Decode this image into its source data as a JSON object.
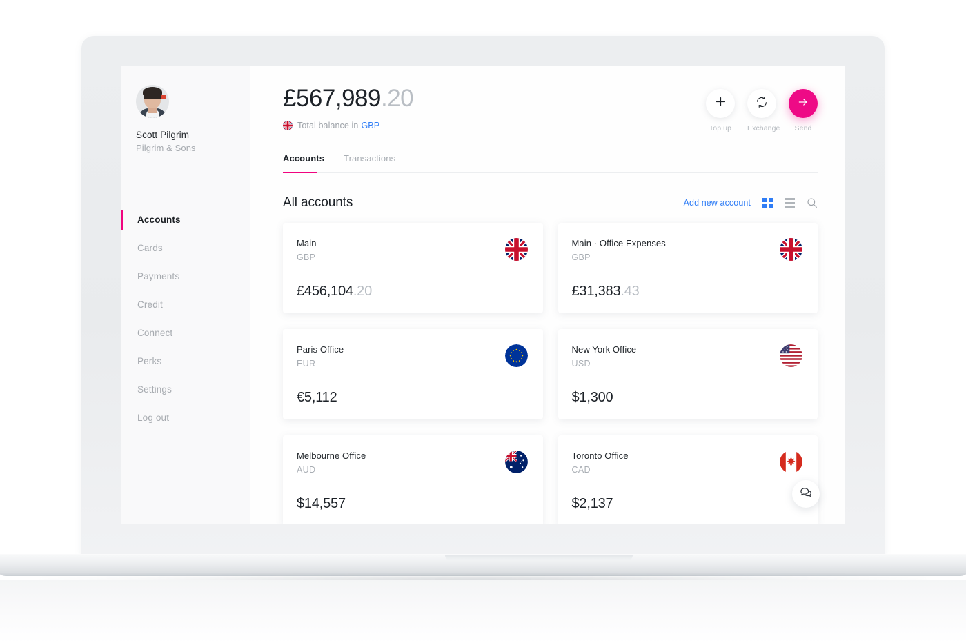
{
  "sidebar": {
    "profile": {
      "avatar_icon": "user-avatar-photo",
      "name": "Scott Pilgrim",
      "company": "Pilgrim & Sons"
    },
    "items": [
      {
        "label": "Accounts",
        "active": true
      },
      {
        "label": "Cards",
        "active": false
      },
      {
        "label": "Payments",
        "active": false
      },
      {
        "label": "Credit",
        "active": false
      },
      {
        "label": "Connect",
        "active": false
      },
      {
        "label": "Perks",
        "active": false
      },
      {
        "label": "Settings",
        "active": false
      },
      {
        "label": "Log out",
        "active": false
      }
    ]
  },
  "header": {
    "balance_main": "£567,989",
    "balance_decimals": ".20",
    "subtitle_prefix": "Total balance in",
    "subtitle_currency": "GBP",
    "subtitle_flag": "gb-flag-icon",
    "actions": [
      {
        "label": "Top up",
        "icon": "plus-icon",
        "style": "light"
      },
      {
        "label": "Exchange",
        "icon": "exchange-refresh-icon",
        "style": "light"
      },
      {
        "label": "Send",
        "icon": "arrow-right-icon",
        "style": "pink"
      }
    ]
  },
  "tabs": [
    {
      "label": "Accounts",
      "active": true
    },
    {
      "label": "Transactions",
      "active": false
    }
  ],
  "section": {
    "title": "All accounts",
    "add_link": "Add new account",
    "grid_view_icon": "grid-view-icon",
    "list_view_icon": "list-view-icon",
    "search_icon": "search-icon"
  },
  "accounts": [
    {
      "name": "Main",
      "currency": "GBP",
      "amount_main": "£456,104",
      "amount_decimals": ".20",
      "flag": "gb-flag-icon"
    },
    {
      "name": "Main · Office Expenses",
      "currency": "GBP",
      "amount_main": "£31,383",
      "amount_decimals": ".43",
      "flag": "gb-flag-icon"
    },
    {
      "name": "Paris Office",
      "currency": "EUR",
      "amount_main": "€5,112",
      "amount_decimals": "",
      "flag": "eu-flag-icon"
    },
    {
      "name": "New York Office",
      "currency": "USD",
      "amount_main": "$1,300",
      "amount_decimals": "",
      "flag": "us-flag-icon"
    },
    {
      "name": "Melbourne Office",
      "currency": "AUD",
      "amount_main": "$14,557",
      "amount_decimals": "",
      "flag": "au-flag-icon"
    },
    {
      "name": "Toronto Office",
      "currency": "CAD",
      "amount_main": "$2,137",
      "amount_decimals": "",
      "flag": "ca-flag-icon"
    }
  ],
  "support": {
    "icon": "chat-bubble-icon"
  },
  "colors": {
    "accent_pink": "#f0047f",
    "send_pink": "#ee0a86",
    "link_blue": "#2f7df6",
    "text_dark": "#1d2228",
    "text_muted": "#a9aeb4",
    "sidebar_bg": "#f9f9fa"
  }
}
